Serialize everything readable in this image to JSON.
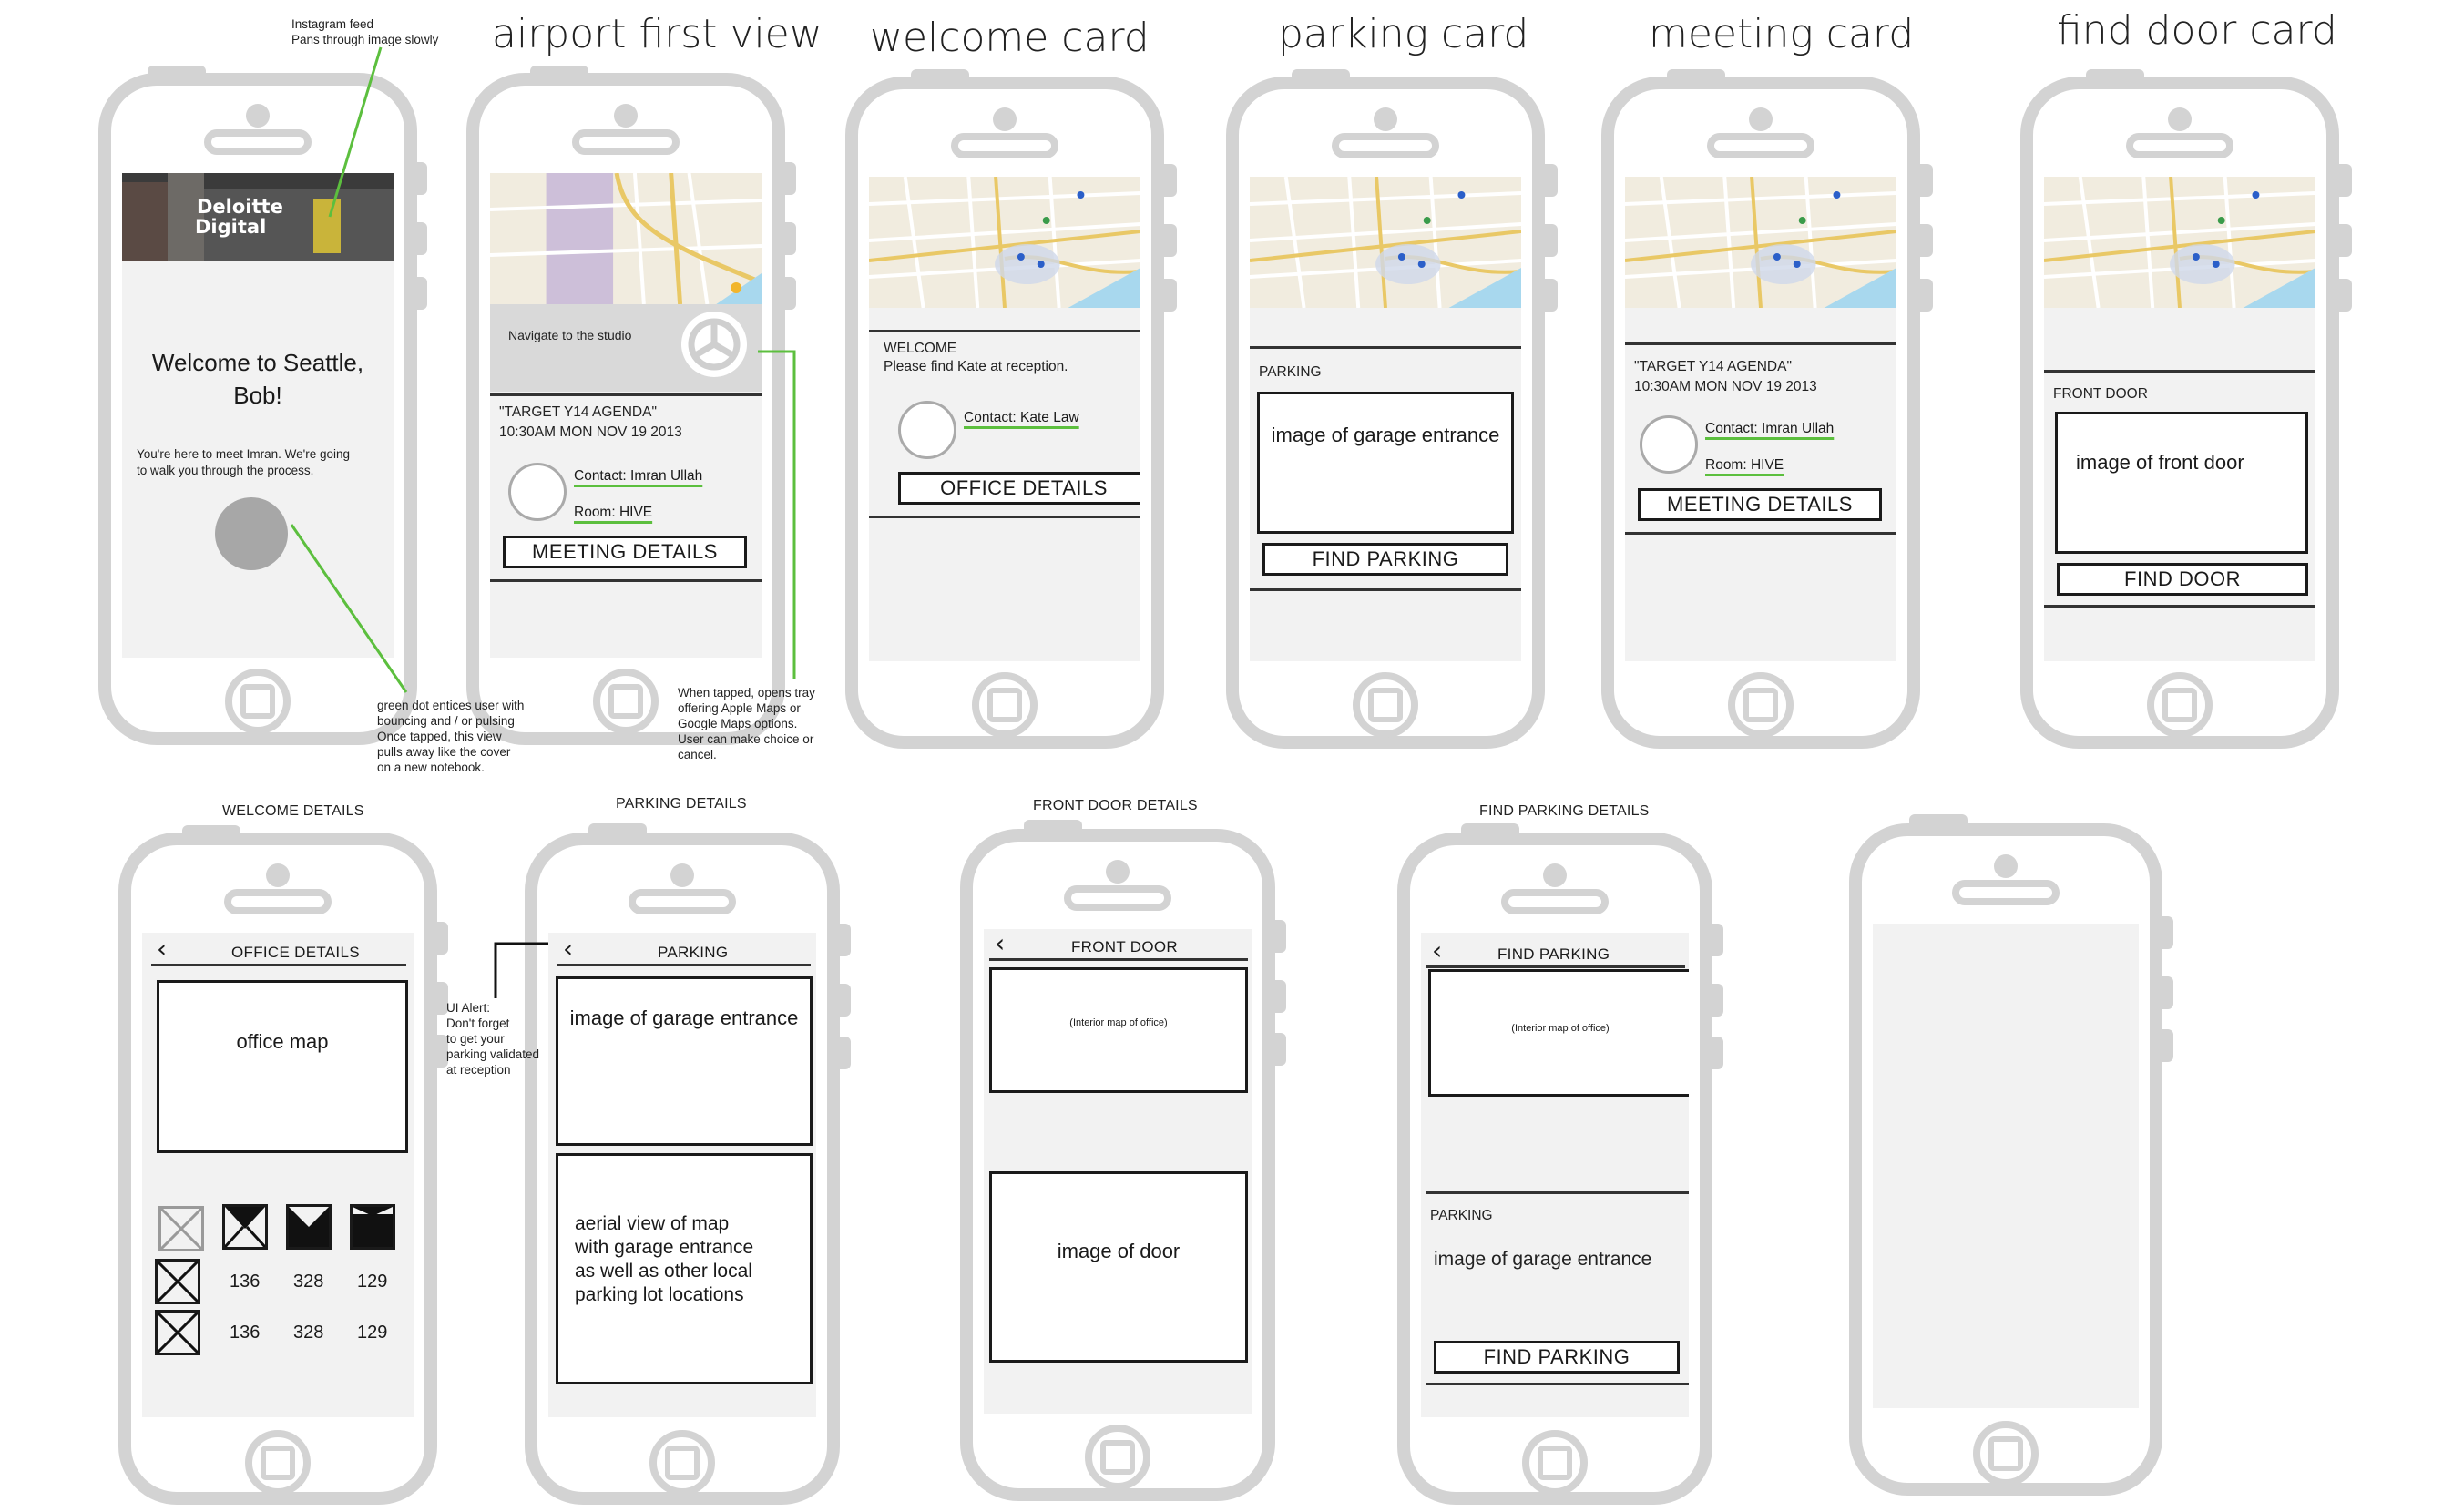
{
  "titles": {
    "airport": "airport first view",
    "welcome": "welcome card",
    "parking": "parking card",
    "meeting": "meeting card",
    "findDoor": "find door card",
    "welcomeDetails": "WELCOME DETAILS",
    "parkingDetails": "PARKING DETAILS",
    "frontDoorDetails": "FRONT DOOR DETAILS",
    "findParkingDetails": "FIND PARKING DETAILS"
  },
  "notes": {
    "instagram": [
      "Instagram feed",
      "Pans through image slowly"
    ],
    "greenDot": [
      "green dot entices user with",
      "bouncing and / or pulsing",
      "Once tapped, this view",
      "pulls away like the cover",
      "on a new notebook."
    ],
    "tray": [
      "When tapped, opens tray",
      "offering Apple Maps or",
      "Google Maps options.",
      "User can make choice or",
      "cancel."
    ],
    "uiAlert": [
      "UI Alert:",
      "Don't forget",
      "to get your",
      "parking validated",
      "at reception"
    ]
  },
  "intro": {
    "logo": [
      "Deloitte",
      "Digital"
    ],
    "welcome": [
      "Welcome to Seattle,",
      "Bob!"
    ],
    "body": [
      "You're here to meet Imran. We're going",
      "to walk you through the process."
    ]
  },
  "airport": {
    "navigate": "Navigate to the studio",
    "agenda": "\"TARGET Y14 AGENDA\"",
    "time": "10:30AM MON NOV 19 2013",
    "contact": "Contact: Imran Ullah",
    "room": "Room: HIVE",
    "button": "MEETING DETAILS"
  },
  "welcomeCard": {
    "label": "WELCOME",
    "text": "Please find Kate at reception.",
    "contact": "Contact: Kate Law",
    "button": "OFFICE DETAILS"
  },
  "parkingCard": {
    "label": "PARKING",
    "image": "image of garage entrance",
    "button": "FIND PARKING"
  },
  "meetingCard": {
    "agenda": "\"TARGET Y14 AGENDA\"",
    "time": "10:30AM MON NOV 19 2013",
    "contact": "Contact: Imran Ullah",
    "room": "Room: HIVE",
    "button": "MEETING DETAILS"
  },
  "findDoorCard": {
    "label": "FRONT DOOR",
    "image": "image of front door",
    "button": "FIND DOOR"
  },
  "officeDetails": {
    "header": "OFFICE DETAILS",
    "map": "office map",
    "row1": [
      "136",
      "328",
      "129"
    ],
    "row2": [
      "136",
      "328",
      "129"
    ]
  },
  "parkingDetails": {
    "header": "PARKING",
    "image": "image of garage entrance",
    "aerial": [
      "aerial view of map",
      "with garage entrance",
      "as well as other local",
      "parking lot locations"
    ]
  },
  "frontDoorDetails": {
    "header": "FRONT DOOR",
    "interior": "(Interior map of office)",
    "image": "image of door"
  },
  "findParkingDetails": {
    "header": "FIND PARKING",
    "interior": "(Interior map of office)",
    "label": "PARKING",
    "image": "image of garage entrance",
    "button": "FIND PARKING"
  },
  "colors": {
    "accent": "#5cbf3e",
    "chassis": "#d3d3d3",
    "screen": "#f2f2f2",
    "mapWater": "#a8d8ee"
  }
}
